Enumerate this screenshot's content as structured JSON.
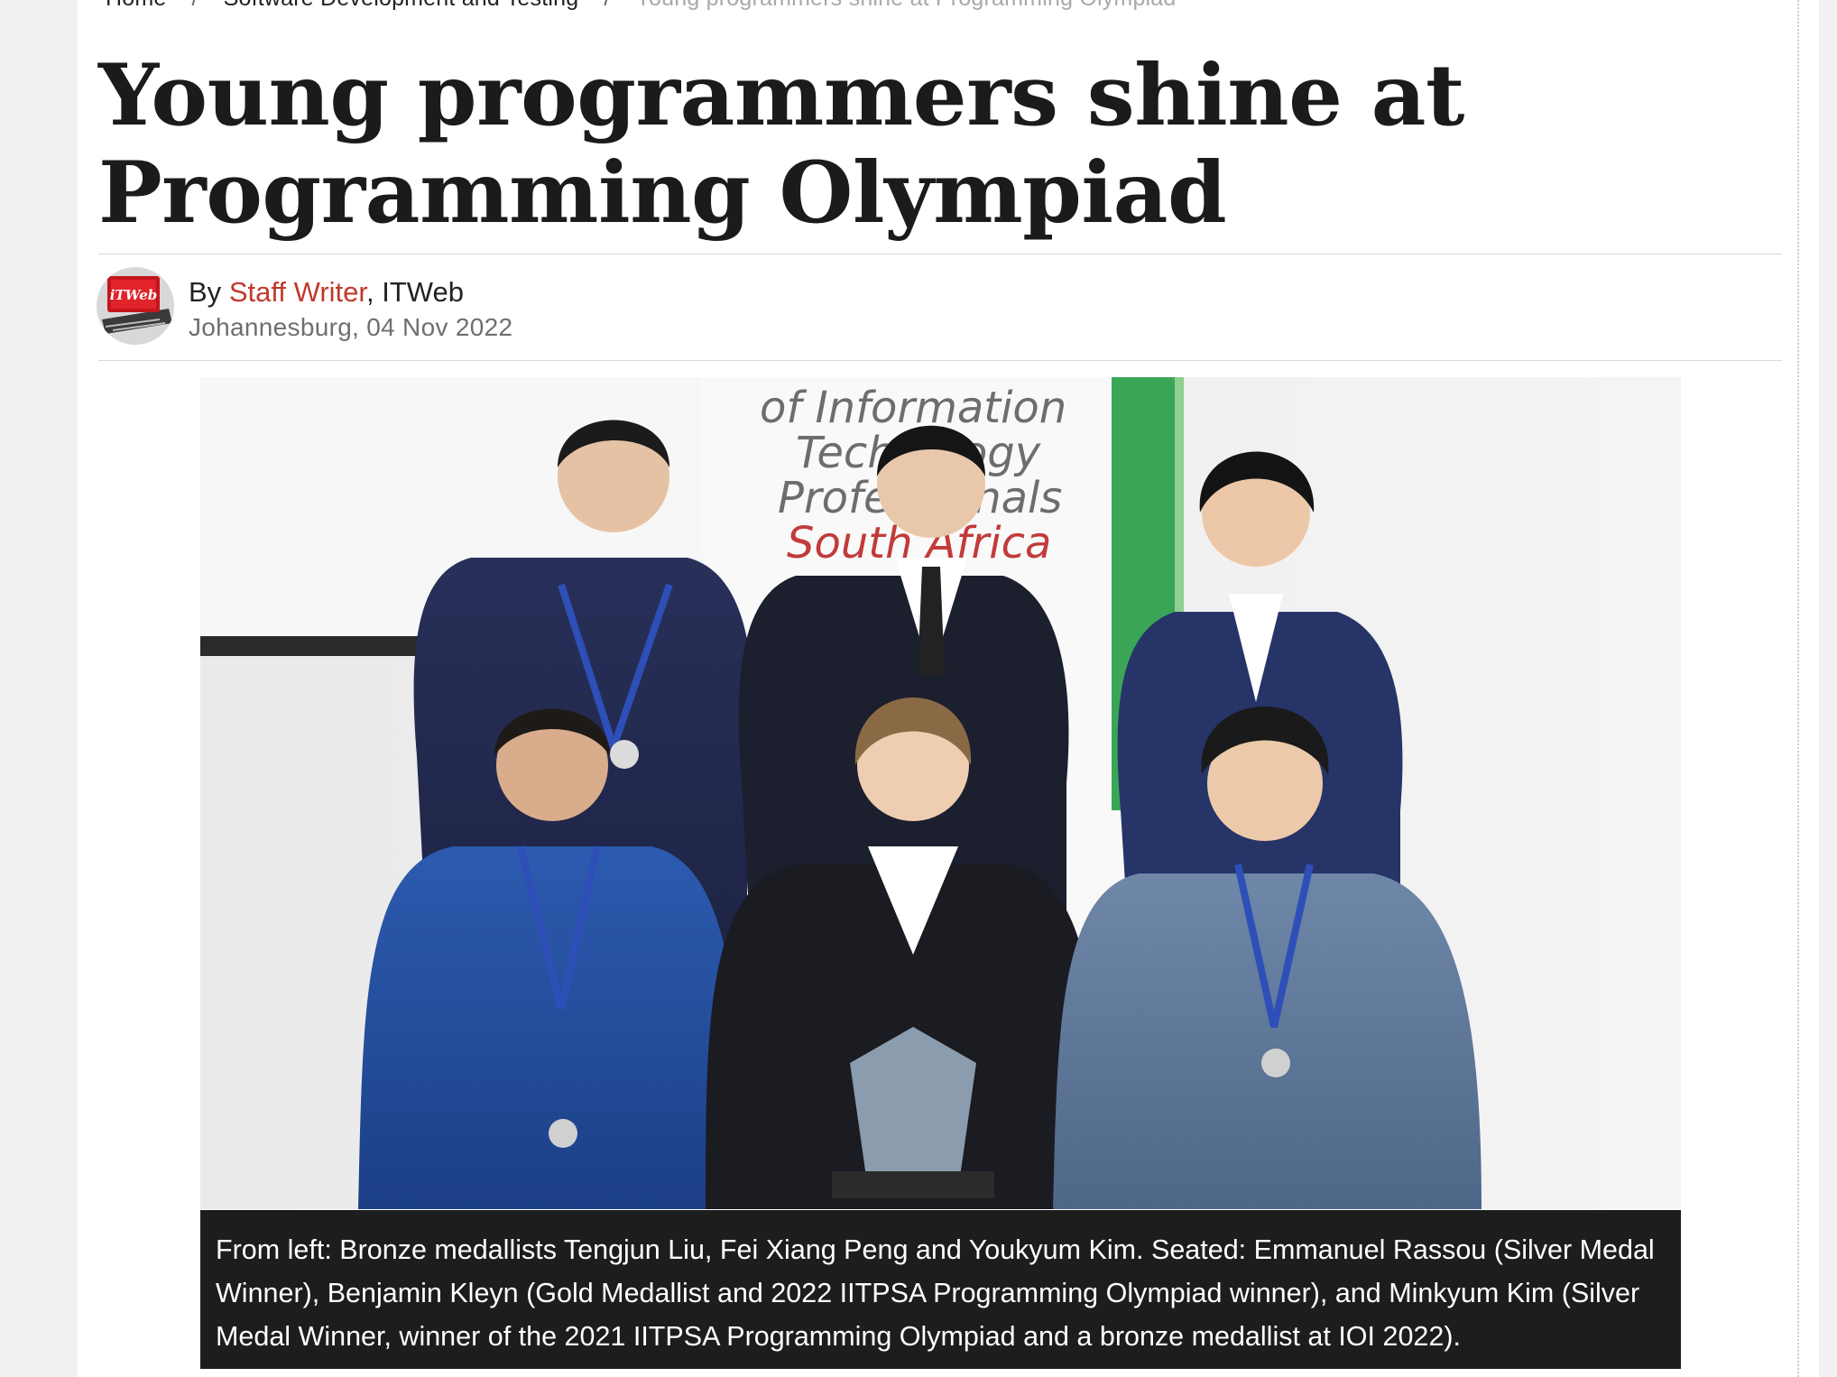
{
  "breadcrumb": {
    "home": "Home",
    "category": "Software Development and Testing",
    "current": "Young programmers shine at Programming Olympiad",
    "separator": "/"
  },
  "article": {
    "title": "Young programmers shine at Programming Olympiad",
    "byline_prefix": "By",
    "author": "Staff Writer",
    "publication": ", ITWeb",
    "dateline": "Johannesburg, 04 Nov 2022",
    "avatar_logo_text": "iTWeb",
    "photo_banner_lines": [
      "of Information",
      "Technology",
      "Professionals",
      "South Africa"
    ],
    "caption": "From left: Bronze medallists Tengjun Liu, Fei Xiang Peng and Youkyum Kim. Seated: Emmanuel Rassou (Silver Medal Winner), Benjamin Kleyn (Gold Medallist and 2022 IITPSA Programming Olympiad winner), and Minkyum Kim (Silver Medal Winner, winner of the 2021 IITPSA Programming Olympiad and a bronze medallist at IOI 2022)."
  },
  "colors": {
    "link": "#c0392b",
    "caption_bg": "#1d1d1d",
    "title": "#1b1b1b"
  }
}
